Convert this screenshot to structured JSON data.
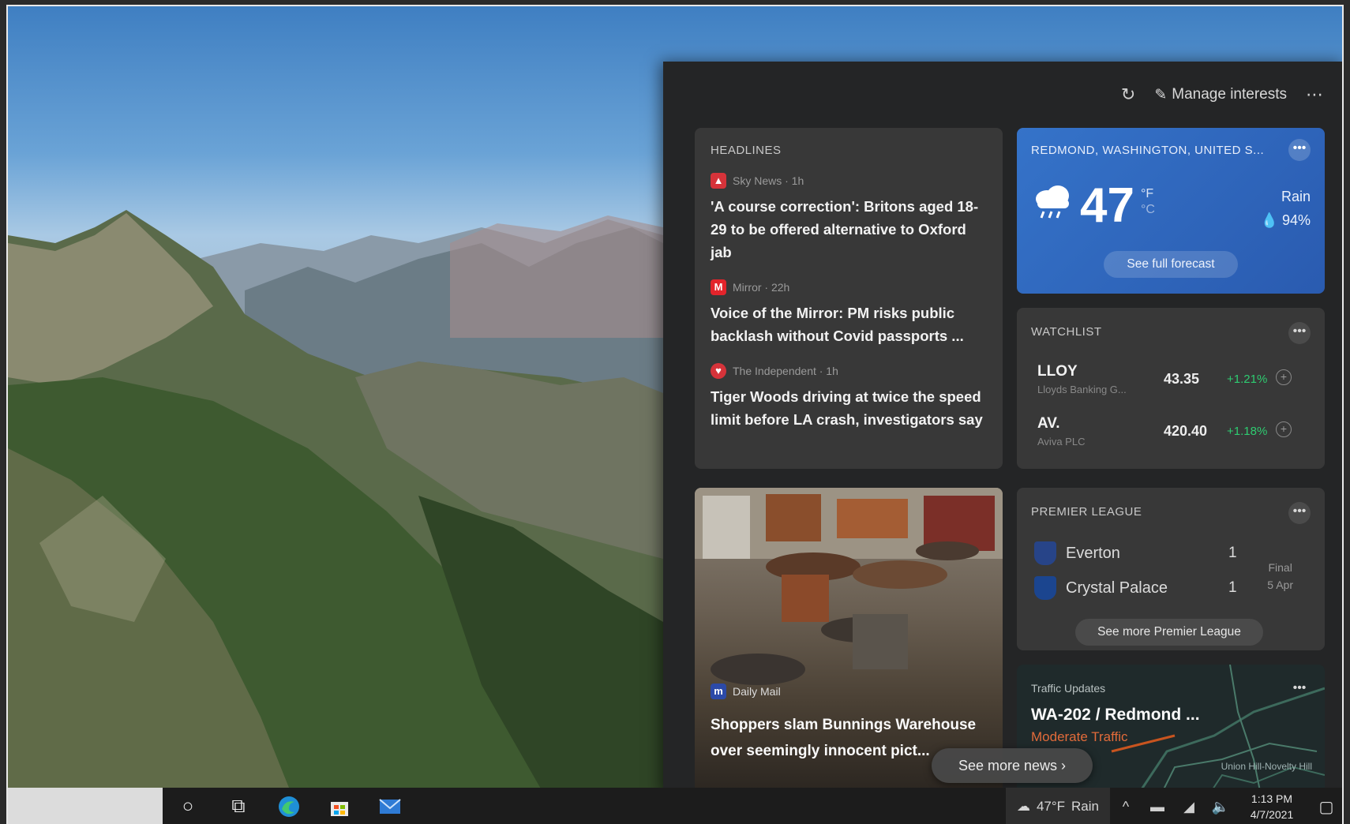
{
  "panel": {
    "manage_label": "Manage interests",
    "refresh_icon": "refresh-icon",
    "more_icon": "more-icon"
  },
  "headlines": {
    "title": "HEADLINES",
    "items": [
      {
        "source": "Sky News · 1h",
        "text": "'A course correction': Britons aged 18-29 to be offered alternative to Oxford jab",
        "icon_color": "#d6333a"
      },
      {
        "source": "Mirror · 22h",
        "text": "Voice of the Mirror: PM risks public backlash without Covid passports ...",
        "icon_letter": "M",
        "icon_color": "#e3242b"
      },
      {
        "source": "The Independent · 1h",
        "text": "Tiger Woods driving at twice the speed limit before LA crash, investigators say",
        "icon_color": "#d6333a"
      }
    ]
  },
  "weather": {
    "title": "REDMOND, WASHINGTON, UNITED S...",
    "temp": "47",
    "unit_f": "°F",
    "unit_c": "°C",
    "condition": "Rain",
    "precip": "94%",
    "forecast_label": "See full forecast",
    "accent": "#3573c9"
  },
  "watchlist": {
    "title": "WATCHLIST",
    "stocks": [
      {
        "symbol": "LLOY",
        "name": "Lloyds Banking G...",
        "price": "43.35",
        "change": "+1.21%"
      },
      {
        "symbol": "AV.",
        "name": "Aviva PLC",
        "price": "420.40",
        "change": "+1.18%"
      }
    ]
  },
  "photo_news": {
    "source": "Daily Mail",
    "source_letter": "m",
    "text": "Shoppers slam Bunnings Warehouse over seemingly innocent pict..."
  },
  "league": {
    "title": "PREMIER LEAGUE",
    "teams": [
      {
        "name": "Everton",
        "score": "1",
        "color": "#274488"
      },
      {
        "name": "Crystal Palace",
        "score": "1",
        "color": "#1b458f"
      }
    ],
    "status": "Final",
    "date": "5 Apr",
    "more_label": "See more Premier League"
  },
  "traffic": {
    "title": "Traffic Updates",
    "route": "WA-202 / Redmond ...",
    "status": "Moderate Traffic",
    "map_label": "Union Hill-Novelty Hill"
  },
  "see_more": "See more news",
  "taskbar": {
    "weather": "47°F",
    "weather_cond": "Rain",
    "time": "1:13 PM",
    "date": "4/7/2021"
  }
}
